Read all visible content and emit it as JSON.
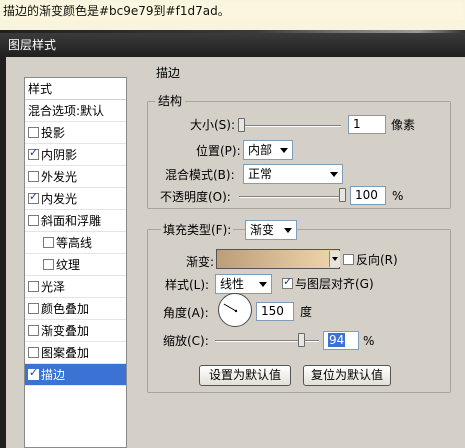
{
  "caption": "描边的渐变颜色是#bc9e79到#f1d7ad。",
  "window": {
    "title": "图层样式"
  },
  "sidebar": {
    "header": "样式",
    "items": [
      {
        "label": "混合选项:默认",
        "checkbox": false,
        "checked": false,
        "selected": false
      },
      {
        "label": "投影",
        "checkbox": true,
        "checked": false,
        "selected": false
      },
      {
        "label": "内阴影",
        "checkbox": true,
        "checked": true,
        "selected": false
      },
      {
        "label": "外发光",
        "checkbox": true,
        "checked": false,
        "selected": false
      },
      {
        "label": "内发光",
        "checkbox": true,
        "checked": true,
        "selected": false
      },
      {
        "label": "斜面和浮雕",
        "checkbox": true,
        "checked": false,
        "selected": false
      },
      {
        "label": "等高线",
        "checkbox": true,
        "checked": false,
        "selected": false
      },
      {
        "label": "纹理",
        "checkbox": true,
        "checked": false,
        "selected": false
      },
      {
        "label": "光泽",
        "checkbox": true,
        "checked": false,
        "selected": false
      },
      {
        "label": "颜色叠加",
        "checkbox": true,
        "checked": false,
        "selected": false
      },
      {
        "label": "渐变叠加",
        "checkbox": true,
        "checked": false,
        "selected": false
      },
      {
        "label": "图案叠加",
        "checkbox": true,
        "checked": false,
        "selected": false
      },
      {
        "label": "描边",
        "checkbox": true,
        "checked": true,
        "selected": true
      }
    ]
  },
  "stroke": {
    "section_title": "描边",
    "structure": {
      "title": "结构",
      "size_label": "大小(S):",
      "size_value": "1",
      "size_unit": "像素",
      "position_label": "位置(P):",
      "position_value": "内部",
      "blend_label": "混合模式(B):",
      "blend_value": "正常",
      "opacity_label": "不透明度(O):",
      "opacity_value": "100",
      "opacity_unit": "%",
      "opacity_level": 1.0
    },
    "fill": {
      "fill_type_label": "填充类型(F):",
      "fill_type_value": "渐变",
      "gradient_label": "渐变:",
      "gradient_from": "#bc9e79",
      "gradient_to": "#f1d7ad",
      "reverse_label": "反向(R)",
      "reverse_checked": false,
      "style_label": "样式(L):",
      "style_value": "线性",
      "align_label": "与图层对齐(G)",
      "align_checked": true,
      "angle_label": "角度(A):",
      "angle_value": "150",
      "angle_unit": "度",
      "scale_label": "缩放(C):",
      "scale_value": "94",
      "scale_unit": "%",
      "scale_level": 0.94
    },
    "buttons": {
      "make_default": "设置为默认值",
      "reset_default": "复位为默认值"
    }
  }
}
